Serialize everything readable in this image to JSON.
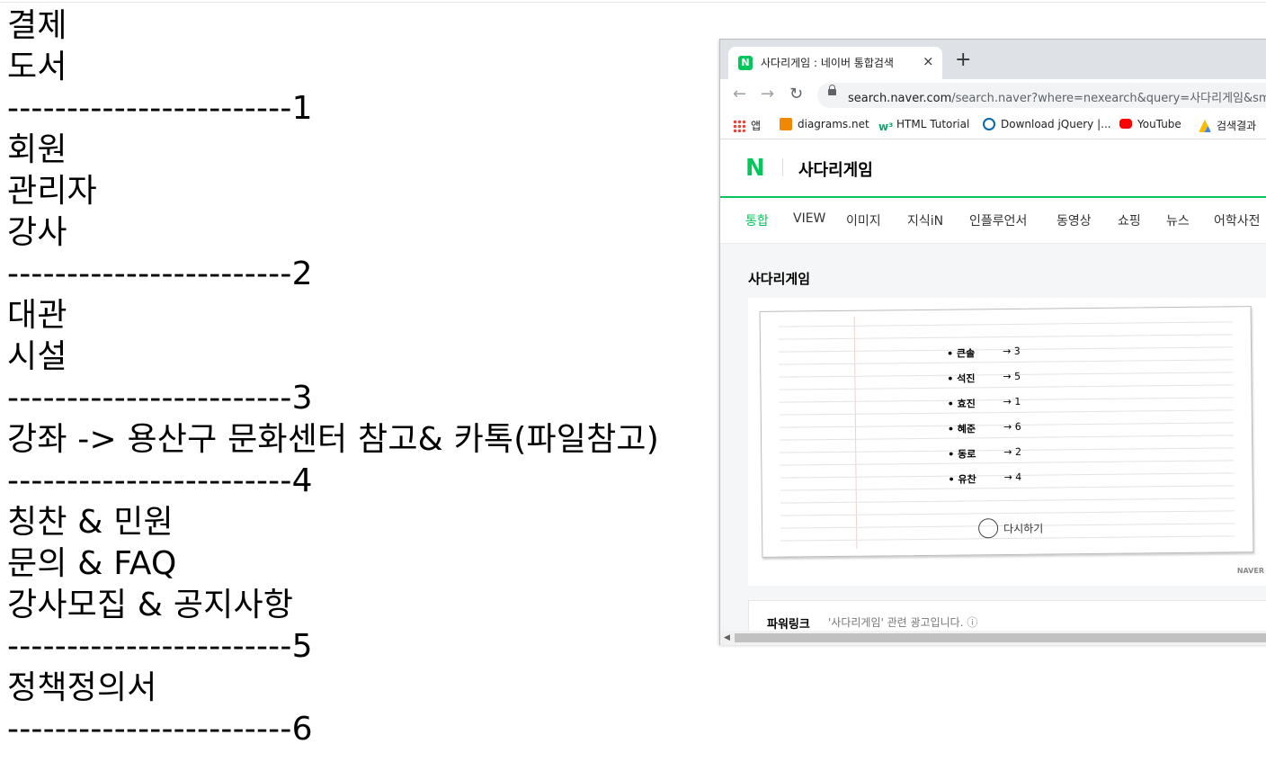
{
  "notes": [
    "결제",
    "도서",
    "------------------------1",
    "회원",
    "관리자",
    "강사",
    "------------------------2",
    "대관",
    "시설",
    "------------------------3",
    "강좌 -> 용산구 문화센터 참고& 카톡(파일참고)",
    "------------------------4",
    "칭찬 & 민원",
    "문의 & FAQ",
    "강사모집 & 공지사항",
    "------------------------5",
    "정책정의서",
    "------------------------6"
  ],
  "browser": {
    "tab_title": "사다리게임 : 네이버 통합검색",
    "tab_favicon": "N",
    "tab_close": "×",
    "new_tab": "+",
    "back_icon": "←",
    "forward_icon": "→",
    "reload_icon": "↻",
    "url_host": "search.naver.com",
    "url_path": "/search.naver?where=nexearch&query=사다리게임&sm=",
    "bookmarks": [
      {
        "label": "앱",
        "icon": "apps-grid-icon"
      },
      {
        "label": "diagrams.net",
        "icon": "diagrams-icon"
      },
      {
        "label": "HTML Tutorial",
        "icon": "w3schools-icon"
      },
      {
        "label": "Download jQuery |...",
        "icon": "jquery-icon"
      },
      {
        "label": "YouTube",
        "icon": "youtube-icon"
      },
      {
        "label": "검색결과",
        "icon": "google-drive-icon"
      }
    ],
    "accent": "#03c75a"
  },
  "naver": {
    "logo": "N",
    "query": "사다리게임",
    "tabs": [
      "통합",
      "VIEW",
      "이미지",
      "지식iN",
      "인플루언서",
      "동영상",
      "쇼핑",
      "뉴스",
      "어학사전"
    ],
    "section_title": "사다리게임",
    "results": [
      {
        "name": "• 큰솔",
        "arrow": "→ 3"
      },
      {
        "name": "• 석진",
        "arrow": "→ 5"
      },
      {
        "name": "• 효진",
        "arrow": "→ 1"
      },
      {
        "name": "• 혜준",
        "arrow": "→ 6"
      },
      {
        "name": "• 동로",
        "arrow": "→ 2"
      },
      {
        "name": "• 유찬",
        "arrow": "→ 4"
      }
    ],
    "retry_label": "다시하기",
    "naver_mark": "NAVER",
    "powerlink_title": "파워링크",
    "powerlink_desc": "'사다리게임' 관련 광고입니다. ⓘ"
  }
}
